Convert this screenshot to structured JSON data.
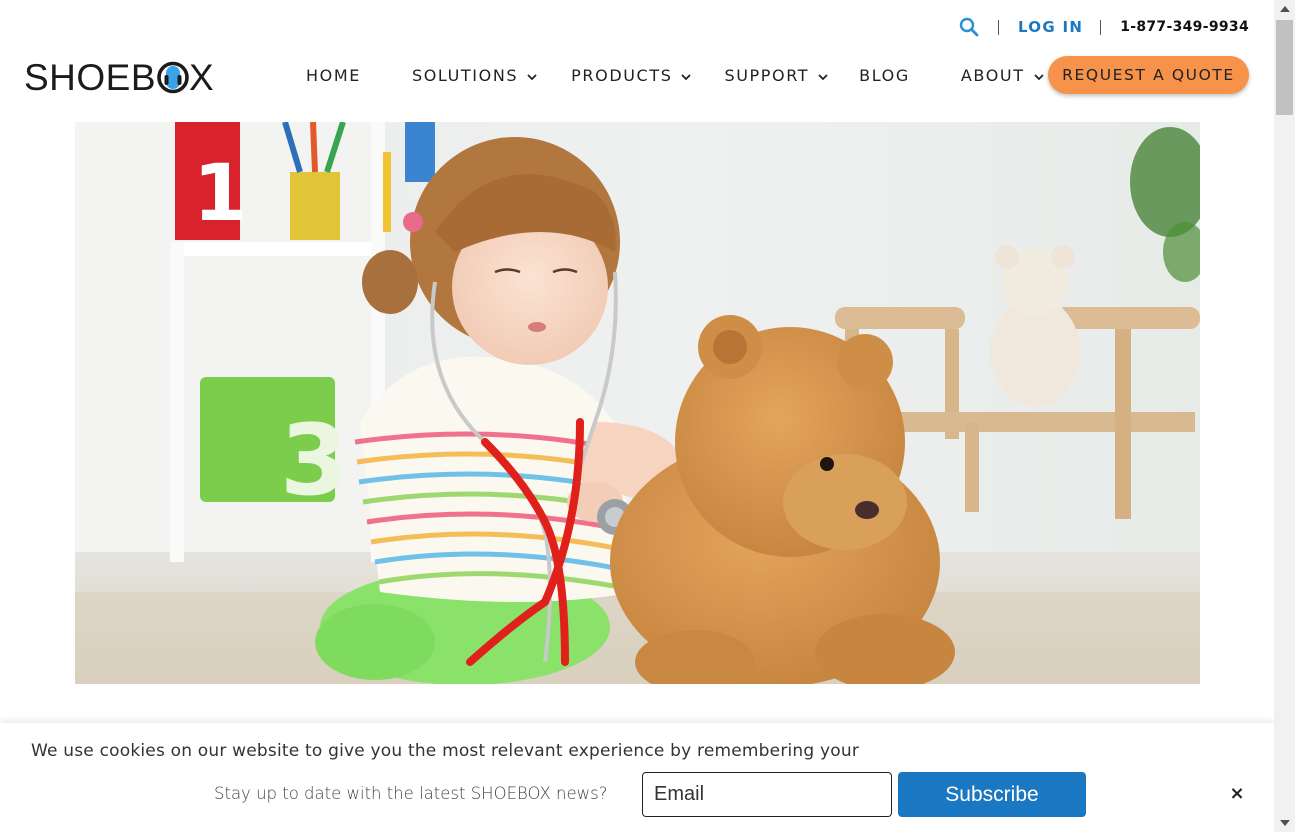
{
  "header": {
    "brand": "SHOEBOX",
    "login_label": "LOG IN",
    "phone": "1-877-349-9934",
    "nav": [
      {
        "label": "HOME",
        "has_dropdown": false
      },
      {
        "label": "SOLUTIONS",
        "has_dropdown": true
      },
      {
        "label": "PRODUCTS",
        "has_dropdown": true
      },
      {
        "label": "SUPPORT",
        "has_dropdown": true
      },
      {
        "label": "BLOG",
        "has_dropdown": false
      },
      {
        "label": "ABOUT",
        "has_dropdown": true
      }
    ],
    "cta_label": "REQUEST A QUOTE"
  },
  "cookie_bar": {
    "text": "We use cookies on our website to give you the most relevant experience by remembering your"
  },
  "newsletter": {
    "prompt": "Stay up to date with the latest SHOEBOX news?",
    "email_placeholder": "Email",
    "subscribe_label": "Subscribe",
    "close_label": "×"
  },
  "colors": {
    "accent_blue": "#1a78c2",
    "cta_orange": "#f7924b",
    "text_dark": "#222222"
  },
  "icons": {
    "search": "search-icon",
    "chevron": "chevron-down-icon",
    "close": "close-icon"
  }
}
